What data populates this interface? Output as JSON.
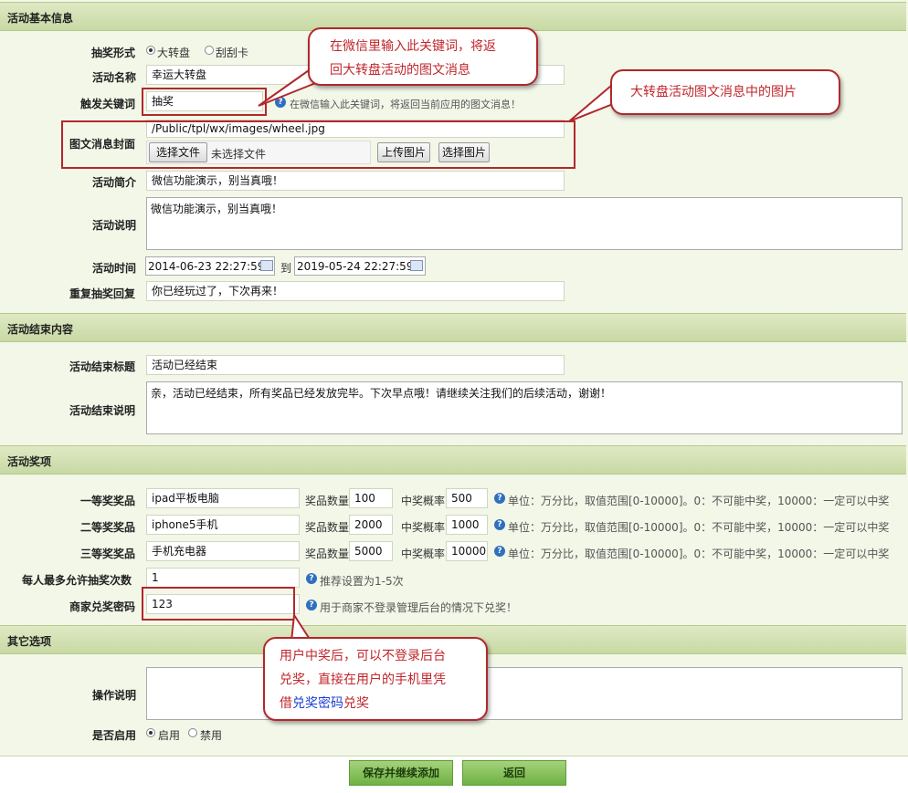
{
  "sections": {
    "basic": "活动基本信息",
    "end": "活动结束内容",
    "prizes": "活动奖项",
    "other": "其它选项"
  },
  "basic": {
    "type_label": "抽奖形式",
    "type_opt1": "大转盘",
    "type_opt2": "刮刮卡",
    "name_label": "活动名称",
    "name_value": "幸运大转盘",
    "keyword_label": "触发关键词",
    "keyword_value": "抽奖",
    "keyword_help": "在微信输入此关键词，将返回当前应用的图文消息！",
    "cover_label": "图文消息封面",
    "cover_path": "/Public/tpl/wx/images/wheel.jpg",
    "choose_file": "选择文件",
    "no_file": "未选择文件",
    "upload_btn": "上传图片",
    "select_btn": "选择图片",
    "intro_label": "活动简介",
    "intro_value": "微信功能演示，别当真哦！",
    "desc_label": "活动说明",
    "desc_value": "微信功能演示，别当真哦！",
    "time_label": "活动时间",
    "time_start": "2014-06-23 22:27:59",
    "time_to": "到",
    "time_end": "2019-05-24 22:27:59",
    "repeat_label": "重复抽奖回复",
    "repeat_value": "你已经玩过了，下次再来！"
  },
  "end": {
    "title_label": "活动结束标题",
    "title_value": "活动已经结束",
    "desc_label": "活动结束说明",
    "desc_value": "亲，活动已经结束，所有奖品已经发放完毕。下次早点哦！请继续关注我们的后续活动，谢谢！"
  },
  "prizes": {
    "qty_label": "奖品数量",
    "rate_label": "中奖概率",
    "rate_help": "单位：万分比，取值范围[0-10000]。0：不可能中奖，10000：一定可以中奖",
    "rows": [
      {
        "label": "一等奖奖品",
        "name": "ipad平板电脑",
        "qty": "100",
        "rate": "500"
      },
      {
        "label": "二等奖奖品",
        "name": "iphone5手机",
        "qty": "2000",
        "rate": "1000"
      },
      {
        "label": "三等奖奖品",
        "name": "手机充电器",
        "qty": "5000",
        "rate": "10000"
      }
    ],
    "max_label": "每人最多允许抽奖次数",
    "max_value": "1",
    "max_help": "推荐设置为1-5次",
    "pwd_label": "商家兑奖密码",
    "pwd_value": "123",
    "pwd_help": "用于商家不登录管理后台的情况下兑奖！"
  },
  "other": {
    "op_label": "操作说明",
    "op_value": "",
    "enable_label": "是否启用",
    "enable_on": "启用",
    "enable_off": "禁用"
  },
  "buttons": {
    "save": "保存并继续添加",
    "back": "返回"
  },
  "callouts": {
    "keyword_line1": "在微信里输入此关键词，将返",
    "keyword_line2": "回大转盘活动的图文消息",
    "cover": "大转盘活动图文消息中的图片",
    "pwd_line1": "用户中奖后，可以不登录后台",
    "pwd_line2": "兑奖，直接在用户的手机里凭",
    "pwd_line3_pre": "借",
    "pwd_line3_link": "兑奖密码",
    "pwd_line3_post": "兑奖"
  },
  "colors": {
    "callout_red": "#b1282c",
    "header_green": "#c8d9a4",
    "button_green": "#6fb244",
    "help_blue": "#2f6fc0"
  }
}
